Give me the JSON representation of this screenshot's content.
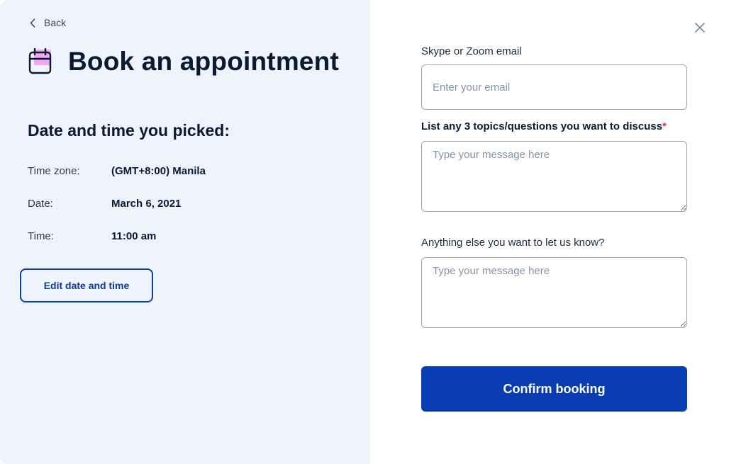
{
  "nav": {
    "back_label": "Back"
  },
  "header": {
    "title": "Book an appointment",
    "icon": "calendar-icon"
  },
  "picked": {
    "heading": "Date and time you picked:",
    "rows": [
      {
        "label": "Time zone:",
        "value": "(GMT+8:00) Manila"
      },
      {
        "label": "Date:",
        "value": "March 6, 2021"
      },
      {
        "label": "Time:",
        "value": "11:00 am"
      }
    ],
    "edit_label": "Edit date and time"
  },
  "form": {
    "email": {
      "label": "Skype or Zoom email",
      "placeholder": "Enter your email",
      "value": ""
    },
    "topics": {
      "label": "List any 3 topics/questions you want to discuss",
      "required_mark": "*",
      "placeholder": "Type your message here",
      "value": ""
    },
    "other": {
      "label": "Anything else you want to let us know?",
      "placeholder": "Type your message here",
      "value": ""
    },
    "submit_label": "Confirm booking"
  },
  "colors": {
    "left_panel_bg": "#eff3fc",
    "primary": "#0a3db3",
    "calendar_accent": "#f2a6f0",
    "required": "#e0303a"
  }
}
